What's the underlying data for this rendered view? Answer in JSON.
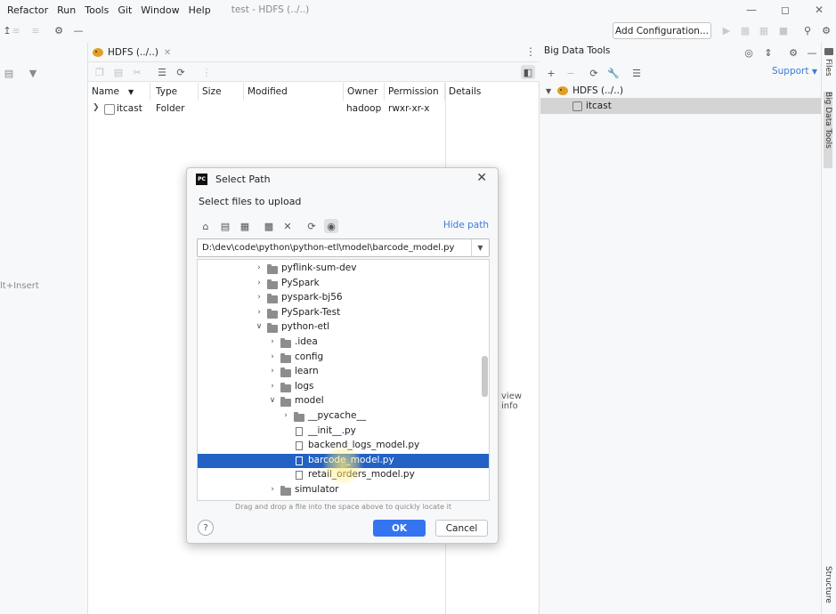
{
  "menu": {
    "items": [
      "Refactor",
      "Run",
      "Tools",
      "Git",
      "Window",
      "Help"
    ],
    "window_title": "test - HDFS (../..)"
  },
  "toolbar": {
    "add_configuration": "Add Configuration...",
    "icons": [
      "run-icon",
      "debug-icon",
      "coverage-icon",
      "stop-icon",
      "search-icon",
      "settings-icon"
    ]
  },
  "left": {
    "shortcut_hint": "lt+Insert"
  },
  "hdfs": {
    "tab_label": "HDFS (../..)",
    "columns": [
      "Name",
      "Type",
      "Size",
      "Modified",
      "Owner",
      "Permission",
      "Details"
    ],
    "rows": [
      {
        "name": "itcast",
        "type": "Folder",
        "size": "",
        "modified": "",
        "owner": "hadoop",
        "permission": "rwxr-xr-x"
      }
    ],
    "view_info": "view info"
  },
  "bdt": {
    "title": "Big Data Tools",
    "support": "Support",
    "tree": [
      {
        "label": "HDFS (../..)"
      },
      {
        "label": "itcast"
      }
    ]
  },
  "right_stripe": {
    "files": "Files",
    "bdt": "Big Data Tools",
    "structure": "Structure"
  },
  "dialog": {
    "title": "Select Path",
    "subtitle": "Select files to upload",
    "hide_path": "Hide path",
    "path": "D:\\dev\\code\\python\\python-etl\\model\\barcode_model.py",
    "tree": [
      {
        "label": "pyflink-sum-dev",
        "kind": "folder",
        "depth": 0,
        "state": "collapsed"
      },
      {
        "label": "PySpark",
        "kind": "folder",
        "depth": 0,
        "state": "collapsed"
      },
      {
        "label": "pyspark-bj56",
        "kind": "folder",
        "depth": 0,
        "state": "collapsed"
      },
      {
        "label": "PySpark-Test",
        "kind": "folder",
        "depth": 0,
        "state": "collapsed"
      },
      {
        "label": "python-etl",
        "kind": "folder",
        "depth": 0,
        "state": "expanded"
      },
      {
        "label": ".idea",
        "kind": "folder",
        "depth": 1,
        "state": "collapsed"
      },
      {
        "label": "config",
        "kind": "folder",
        "depth": 1,
        "state": "collapsed"
      },
      {
        "label": "learn",
        "kind": "folder",
        "depth": 1,
        "state": "collapsed"
      },
      {
        "label": "logs",
        "kind": "folder",
        "depth": 1,
        "state": "collapsed"
      },
      {
        "label": "model",
        "kind": "folder",
        "depth": 1,
        "state": "expanded"
      },
      {
        "label": "__pycache__",
        "kind": "folder",
        "depth": 2,
        "state": "collapsed"
      },
      {
        "label": "__init__.py",
        "kind": "file",
        "depth": 2,
        "state": ""
      },
      {
        "label": "backend_logs_model.py",
        "kind": "file",
        "depth": 2,
        "state": ""
      },
      {
        "label": "barcode_model.py",
        "kind": "file",
        "depth": 2,
        "state": "selected"
      },
      {
        "label": "retail_orders_model.py",
        "kind": "file",
        "depth": 2,
        "state": ""
      },
      {
        "label": "simulator",
        "kind": "folder",
        "depth": 1,
        "state": "collapsed"
      }
    ],
    "drag_hint": "Drag and drop a file into the space above to quickly locate it",
    "help": "?",
    "ok": "OK",
    "cancel": "Cancel"
  }
}
